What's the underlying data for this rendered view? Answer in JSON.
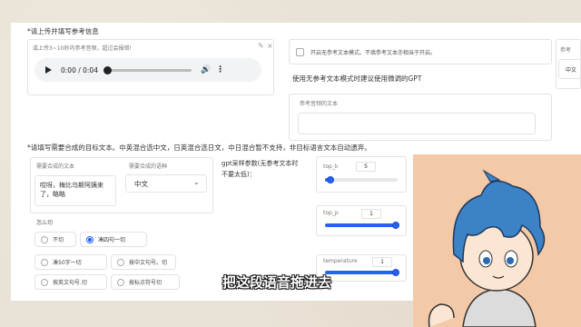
{
  "upload": {
    "label": "*请上传并填写参考信息",
    "file_hint": "或上传3~10秒内参考音频，超过会报错!",
    "audio_time": "0:00 / 0:04"
  },
  "no_ref": {
    "checkbox_label": "开启无参考文本模式。不填参考文本亦相当于开启。",
    "tip": "使用无参考文本模式时建议使用微调的GPT",
    "ref_text_label": "参考音频的文本",
    "right_label": "参考",
    "right_value": "中文"
  },
  "target": {
    "label": "*请填写需要合成的目标文本。中英混合选中文，日英混合选日文，中日混合暂不支持，非目标语言文本自动遗弃。",
    "text_label": "需要合成的文本",
    "text_value": "哎呀，梅比乌斯阿姨来了，略略",
    "lang_label": "需要合成的语种",
    "lang_value": "中文"
  },
  "split": {
    "label": "怎么切",
    "options": [
      "不切",
      "凑四句一切",
      "凑50字一切",
      "按中文句号。切",
      "按英文句号.切",
      "按标点符号切"
    ]
  },
  "gpt": {
    "label": "gpt采样参数(无参考文本时不要太低)：",
    "top_k_label": "top_k",
    "top_k_value": "5",
    "top_p_label": "top_p",
    "top_p_value": "1",
    "temperature_label": "temperature",
    "temperature_value": "1"
  },
  "subtitle": "把这段语音拖进去",
  "colors": {
    "accent": "#2563eb",
    "panel": "#ffffff",
    "background": "#e9e2d6",
    "avatar_bg": "#f3c9a8"
  }
}
